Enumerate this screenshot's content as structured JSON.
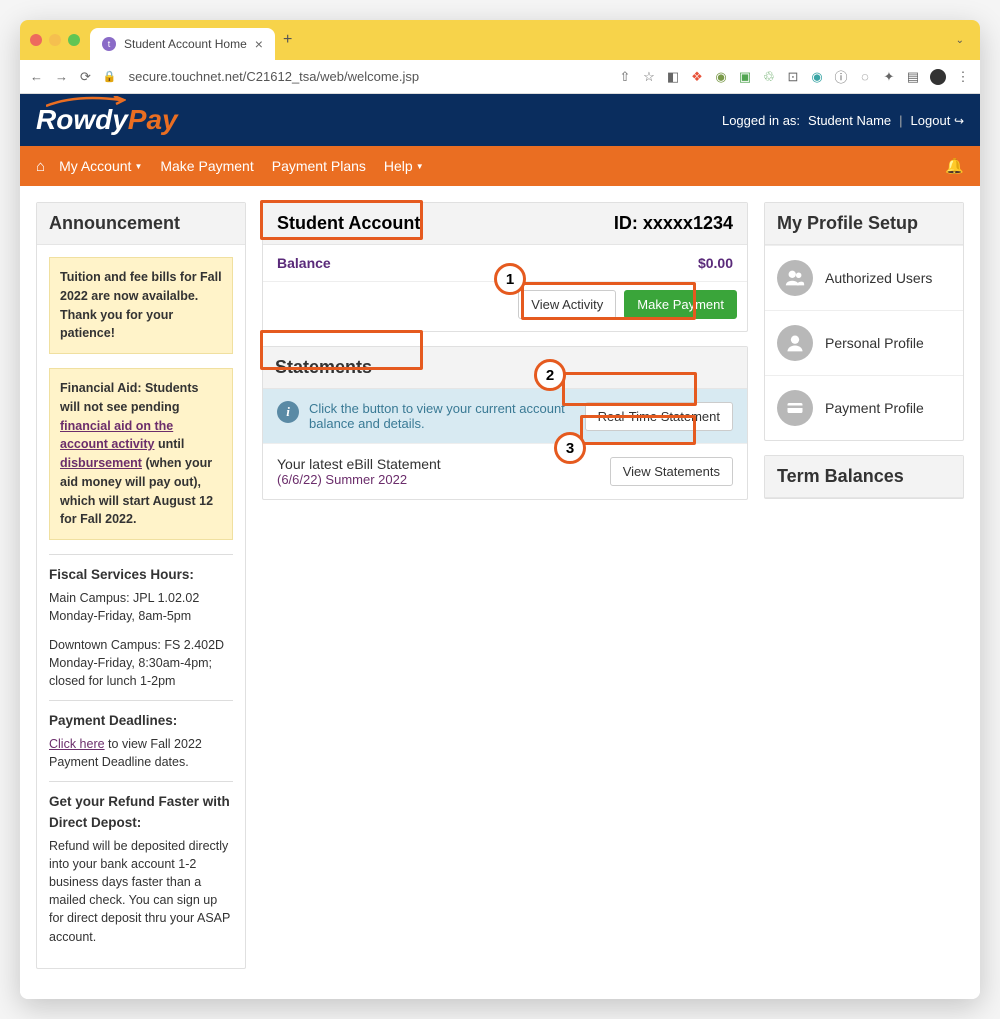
{
  "browser": {
    "tab_title": "Student Account Home",
    "url": "secure.touchnet.net/C21612_tsa/web/welcome.jsp"
  },
  "header": {
    "logo_part1": "Rowdy",
    "logo_part2": "Pay",
    "logged_in_prefix": "Logged in as:",
    "user_name": "Student Name",
    "logout": "Logout"
  },
  "nav": {
    "my_account": "My Account",
    "make_payment": "Make Payment",
    "payment_plans": "Payment Plans",
    "help": "Help"
  },
  "announcement": {
    "title": "Announcement",
    "alert1": "Tuition and fee bills for Fall 2022 are now availalbe. Thank you for your patience!",
    "alert2_prefix": "Financial Aid: Students will not see pending ",
    "alert2_link1": "financial aid on the account activity",
    "alert2_mid": " until ",
    "alert2_link2": "disbursement",
    "alert2_suffix": " (when your aid money will pay out), which will start August 12 for Fall 2022.",
    "hours_title": "Fiscal Services Hours:",
    "hours_line1": "Main Campus: JPL 1.02.02 Monday-Friday, 8am-5pm",
    "hours_line2": "Downtown Campus: FS 2.402D Monday-Friday, 8:30am-4pm; closed for lunch 1-2pm",
    "deadlines_title": "Payment Deadlines:",
    "deadlines_link": "Click here",
    "deadlines_text": " to view Fall 2022 Payment Deadline dates.",
    "refund_title": "Get your Refund Faster with Direct Depost:",
    "refund_text": "Refund will be deposited directly into your bank account 1-2 business days faster than a mailed check. You can sign up for direct deposit thru your ASAP account."
  },
  "account": {
    "title": "Student Account",
    "id_label": "ID:",
    "id_value": "xxxxx1234",
    "balance_label": "Balance",
    "balance_value": "$0.00",
    "view_activity": "View Activity",
    "make_payment": "Make Payment"
  },
  "statements": {
    "title": "Statements",
    "info_text": "Click the button to view your current account balance and details.",
    "realtime_btn": "Real-Time Statement",
    "ebill_title": "Your latest eBill Statement",
    "ebill_date": "(6/6/22) Summer 2022",
    "view_btn": "View Statements"
  },
  "profile": {
    "title": "My Profile Setup",
    "authorized_users": "Authorized Users",
    "personal_profile": "Personal Profile",
    "payment_profile": "Payment Profile"
  },
  "term_balances": {
    "title": "Term Balances"
  },
  "annotations": {
    "n1": "1",
    "n2": "2",
    "n3": "3"
  }
}
